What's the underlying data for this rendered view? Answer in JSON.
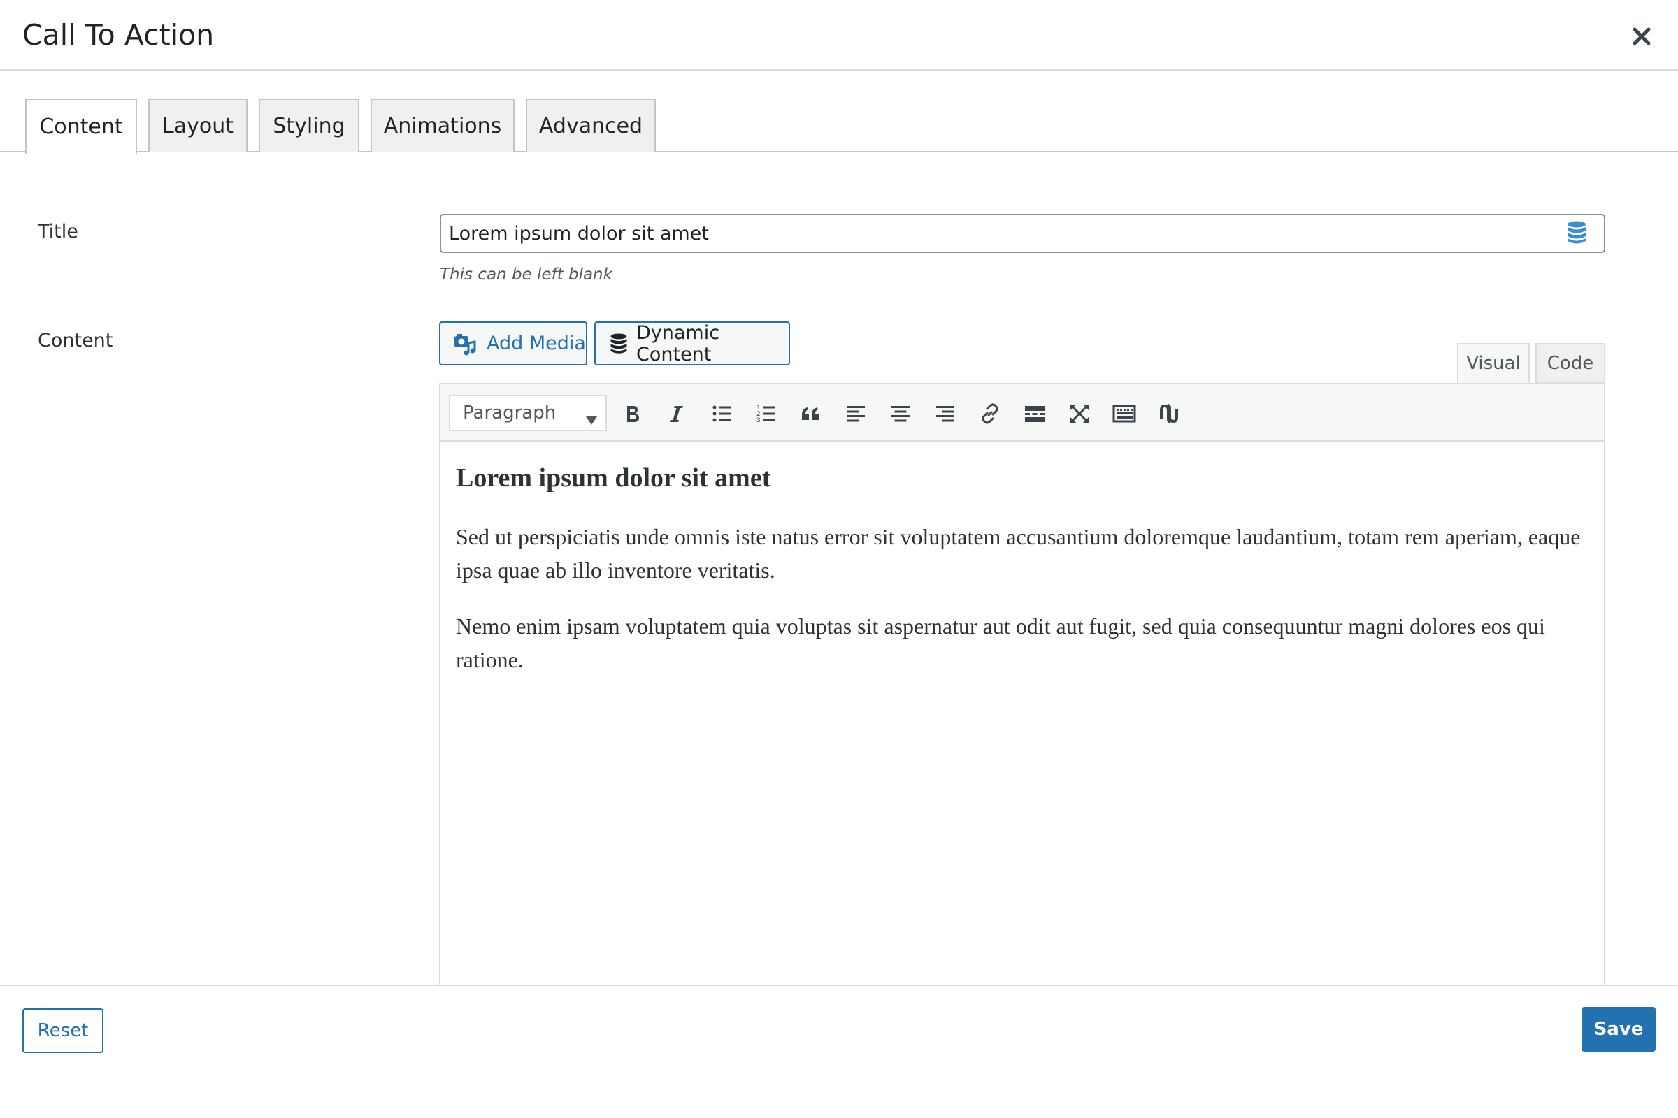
{
  "modal": {
    "title": "Call To Action",
    "close_icon": "close-icon"
  },
  "tabs": [
    {
      "label": "Content",
      "active": true
    },
    {
      "label": "Layout",
      "active": false
    },
    {
      "label": "Styling",
      "active": false
    },
    {
      "label": "Animations",
      "active": false
    },
    {
      "label": "Advanced",
      "active": false
    }
  ],
  "fields": {
    "title": {
      "label": "Title",
      "value": "Lorem ipsum dolor sit amet",
      "hint": "This can be left blank",
      "icon": "database-icon"
    },
    "content": {
      "label": "Content",
      "add_media_label": "Add Media",
      "dynamic_content_label": "Dynamic Content",
      "mode_tabs": [
        "Visual",
        "Code"
      ],
      "active_mode": "Visual",
      "format_select": "Paragraph",
      "toolbar_icons": [
        "bold-icon",
        "italic-icon",
        "bulleted-list-icon",
        "numbered-list-icon",
        "blockquote-icon",
        "align-left-icon",
        "align-center-icon",
        "align-right-icon",
        "link-icon",
        "read-more-icon",
        "fullscreen-icon",
        "toolbar-toggle-icon",
        "shortcode-icon"
      ],
      "heading": "Lorem ipsum dolor sit amet",
      "paragraphs": [
        "Sed ut perspiciatis unde omnis iste natus error sit voluptatem accusantium doloremque laudantium, totam rem aperiam, eaque ipsa quae ab illo inventore veritatis.",
        "Nemo enim ipsam voluptatem quia voluptas sit aspernatur aut odit aut fugit, sed quia consequuntur magni dolores eos qui ratione."
      ]
    }
  },
  "footer": {
    "reset_label": "Reset",
    "save_label": "Save"
  },
  "colors": {
    "accent": "#2271b1",
    "database_icon": "#3a8fd0"
  }
}
